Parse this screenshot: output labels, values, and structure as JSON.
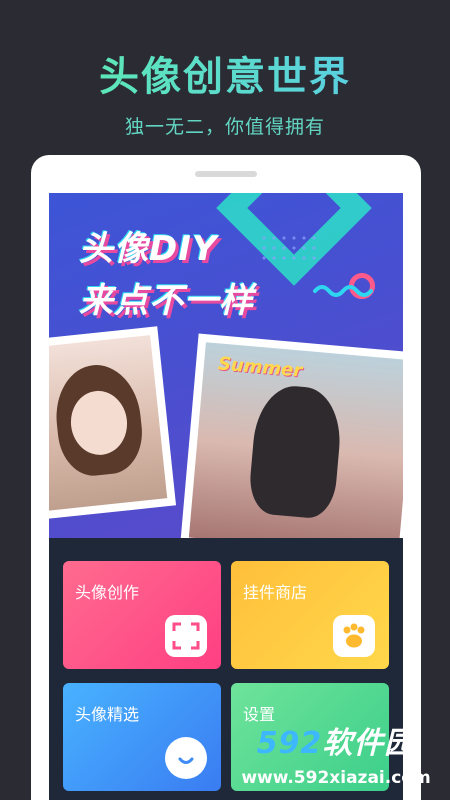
{
  "header": {
    "title": "头像创意世界",
    "subtitle": "独一无二，你值得拥有"
  },
  "banner": {
    "title_line1": "头像DIY",
    "title_line2": "来点不一样",
    "sticker_text": "Summer"
  },
  "menu": {
    "items": [
      {
        "label": "头像创作",
        "icon": "frame-icon",
        "color": "#ff4d89"
      },
      {
        "label": "挂件商店",
        "icon": "paw-icon",
        "color": "#ffc93d"
      },
      {
        "label": "头像精选",
        "icon": "avatar-face-icon",
        "color": "#3f8cf5"
      },
      {
        "label": "设置",
        "icon": "settings-icon",
        "color": "#4dd88e"
      }
    ]
  },
  "watermark": {
    "brand_num": "592",
    "brand_text": "软件园",
    "url": "www.592xiazai.com"
  }
}
